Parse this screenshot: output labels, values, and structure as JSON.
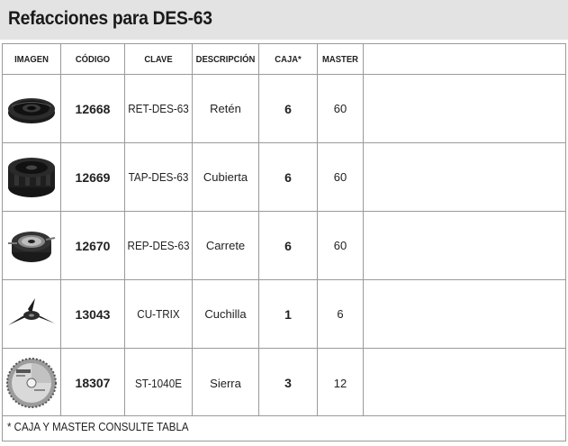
{
  "title": "Refacciones para DES-63",
  "headers": {
    "imagen": "IMAGEN",
    "codigo": "CÓDIGO",
    "clave": "CLAVE",
    "descripcion": "DESCRIPCIÓN",
    "caja": "CAJA*",
    "master": "MASTER"
  },
  "rows": [
    {
      "icon": "spool-cap-retainer-icon",
      "codigo": "12668",
      "clave": "RET-DES-63",
      "descripcion": "Retén",
      "caja": "6",
      "master": "60"
    },
    {
      "icon": "spool-cover-icon",
      "codigo": "12669",
      "clave": "TAP-DES-63",
      "descripcion": "Cubierta",
      "caja": "6",
      "master": "60"
    },
    {
      "icon": "line-spool-reel-icon",
      "codigo": "12670",
      "clave": "REP-DES-63",
      "descripcion": "Carrete",
      "caja": "6",
      "master": "60"
    },
    {
      "icon": "three-blade-cutter-icon",
      "codigo": "13043",
      "clave": "CU-TRIX",
      "descripcion": "Cuchilla",
      "caja": "1",
      "master": "6"
    },
    {
      "icon": "circular-saw-blade-icon",
      "codigo": "18307",
      "clave": "ST-1040E",
      "descripcion": "Sierra",
      "caja": "3",
      "master": "12"
    }
  ],
  "footnote": "* CAJA Y MASTER CONSULTE TABLA"
}
